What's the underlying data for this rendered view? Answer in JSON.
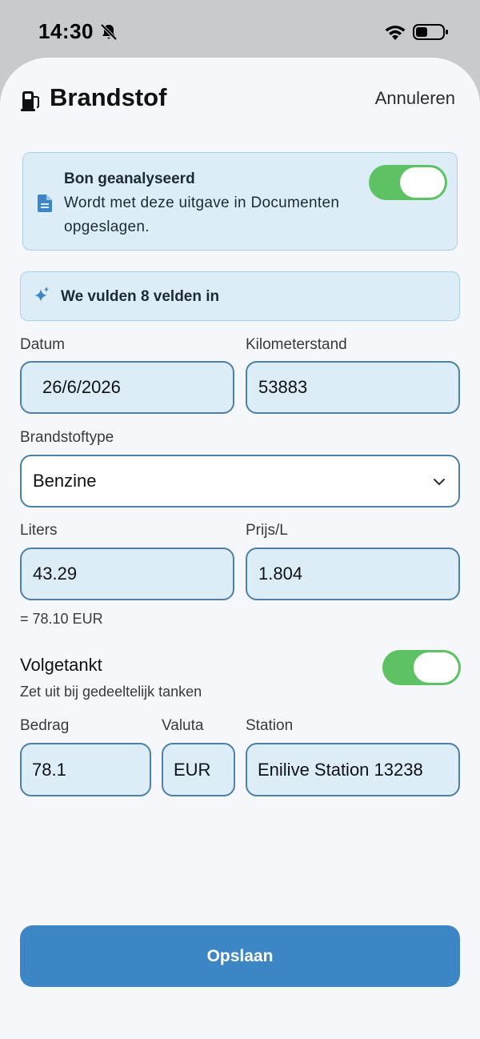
{
  "status_bar": {
    "time": "14:30"
  },
  "header": {
    "title": "Brandstof",
    "cancel_label": "Annuleren"
  },
  "receipt": {
    "title": "Bon geanalyseerd",
    "description": "Wordt met deze uitgave in Documenten opgeslagen.",
    "save_toggle_on": true
  },
  "ai_banner": {
    "text": "We vulden 8 velden in"
  },
  "form": {
    "date": {
      "label": "Datum",
      "value": "26/6/2026"
    },
    "odometer": {
      "label": "Kilometerstand",
      "value": "53883"
    },
    "fuel_type": {
      "label": "Brandstoftype",
      "value": "Benzine"
    },
    "liters": {
      "label": "Liters",
      "value": "43.29"
    },
    "price_per_liter": {
      "label": "Prijs/L",
      "value": "1.804"
    },
    "total_text": "= 78.10 EUR",
    "full_tank": {
      "label": "Volgetankt",
      "hint": "Zet uit bij gedeeltelijk tanken",
      "on": true
    },
    "amount": {
      "label": "Bedrag",
      "value": "78.1"
    },
    "currency": {
      "label": "Valuta",
      "value": "EUR"
    },
    "station": {
      "label": "Station",
      "value": "Enilive Station 13238"
    }
  },
  "save_label": "Opslaan",
  "icons": [
    "bell-slash-icon",
    "wifi-icon",
    "battery-icon",
    "fuel-pump-icon",
    "document-icon",
    "sparkle-icon",
    "chevron-down-icon"
  ],
  "colors": {
    "accent": "#3d86c6",
    "toggle_on": "#5ec265",
    "field_bg": "#dcedf8",
    "field_border": "#4c80a6"
  }
}
